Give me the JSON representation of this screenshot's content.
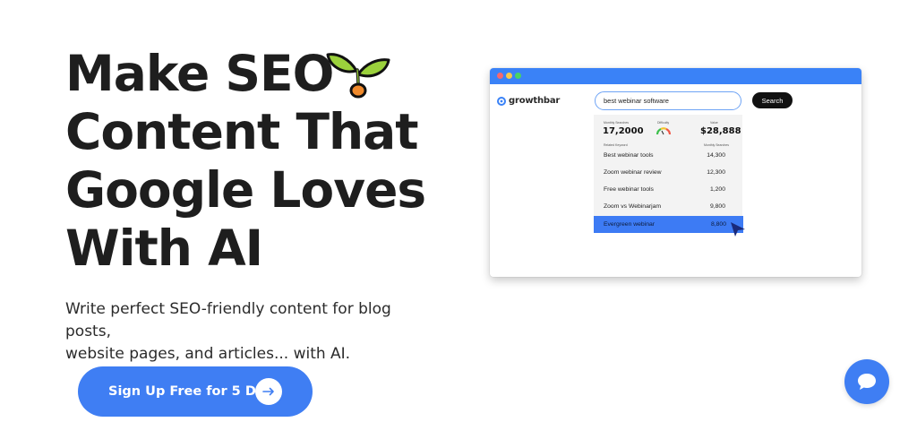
{
  "hero": {
    "title_lines": [
      "Make SEO",
      "Content That",
      "Google Loves",
      "With AI"
    ],
    "subtitle_line1": "Write perfect SEO-friendly content for blog posts,",
    "subtitle_line2": "website pages, and articles... with AI.",
    "cta_label": "Sign Up Free for 5 Days",
    "accent_color": "#3f7ef3"
  },
  "mockup": {
    "brand": "growthbar",
    "search_value": "best webinar software",
    "search_button": "Search",
    "metrics": {
      "monthly_searches_label": "Monthly Searches",
      "monthly_searches_value": "17,2000",
      "difficulty_label": "Difficulty",
      "value_label": "Value",
      "value_value": "$28,888"
    },
    "columns": {
      "keyword": "Related Keyword",
      "searches": "Monthly Searches"
    },
    "keywords": [
      {
        "name": "Best webinar tools",
        "volume": "14,300"
      },
      {
        "name": "Zoom webinar review",
        "volume": "12,300"
      },
      {
        "name": "Free webinar tools",
        "volume": "1,200"
      },
      {
        "name": "Zoom vs Webinarjam",
        "volume": "9,800"
      },
      {
        "name": "Evergreen webinar",
        "volume": "8,800"
      }
    ]
  },
  "icons": {
    "sprout": "sprout-icon",
    "arrow": "arrow-right-icon",
    "chat": "chat-icon"
  }
}
